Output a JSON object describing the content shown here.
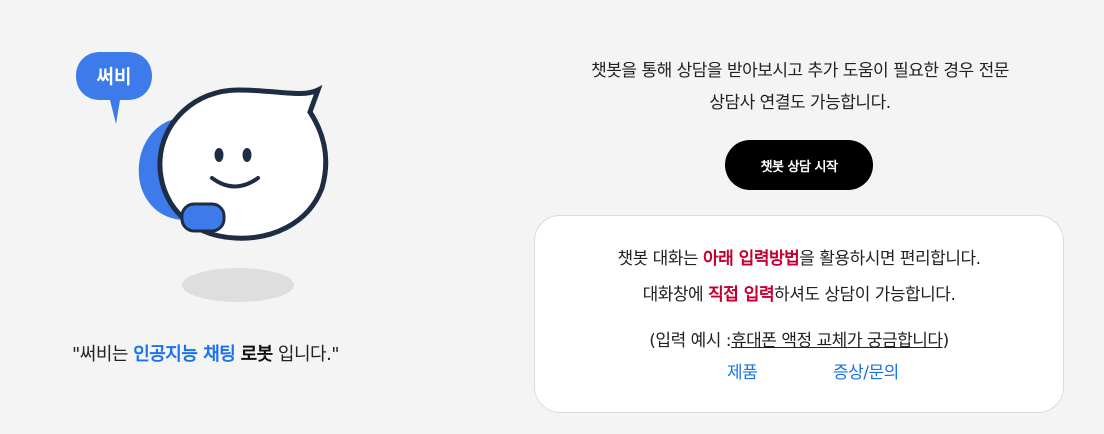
{
  "mascot": {
    "bubble_label": "써비"
  },
  "intro": {
    "prefix": "\"써비는 ",
    "highlight": "인공지능 채팅",
    "bold": "로봇",
    "suffix": " 입니다.\""
  },
  "description": {
    "line1": "챗봇을 통해 상담을 받아보시고 추가 도움이 필요한 경우 전문",
    "line2": "상담사 연결도 가능합니다."
  },
  "start_button": {
    "label": "챗봇 상담 시작"
  },
  "help": {
    "line1_pre": "챗봇 대화는 ",
    "line1_hl": "아래 입력방법",
    "line1_post": "을 활용하시면 편리합니다.",
    "line2_pre": "대화창에 ",
    "line2_hl": "직접 입력",
    "line2_post": "하셔도 상담이 가능합니다.",
    "example_prefix": "(입력 예시 :",
    "example_text": "휴대폰 액정 교체가 궁금합니다",
    "example_suffix": ")",
    "tags": [
      "제품",
      "증상/문의"
    ]
  },
  "colors": {
    "accent_blue": "#1a73e8",
    "highlight_red": "#c3002f",
    "mascot_blue": "#3d7bea",
    "button_black": "#000000"
  }
}
